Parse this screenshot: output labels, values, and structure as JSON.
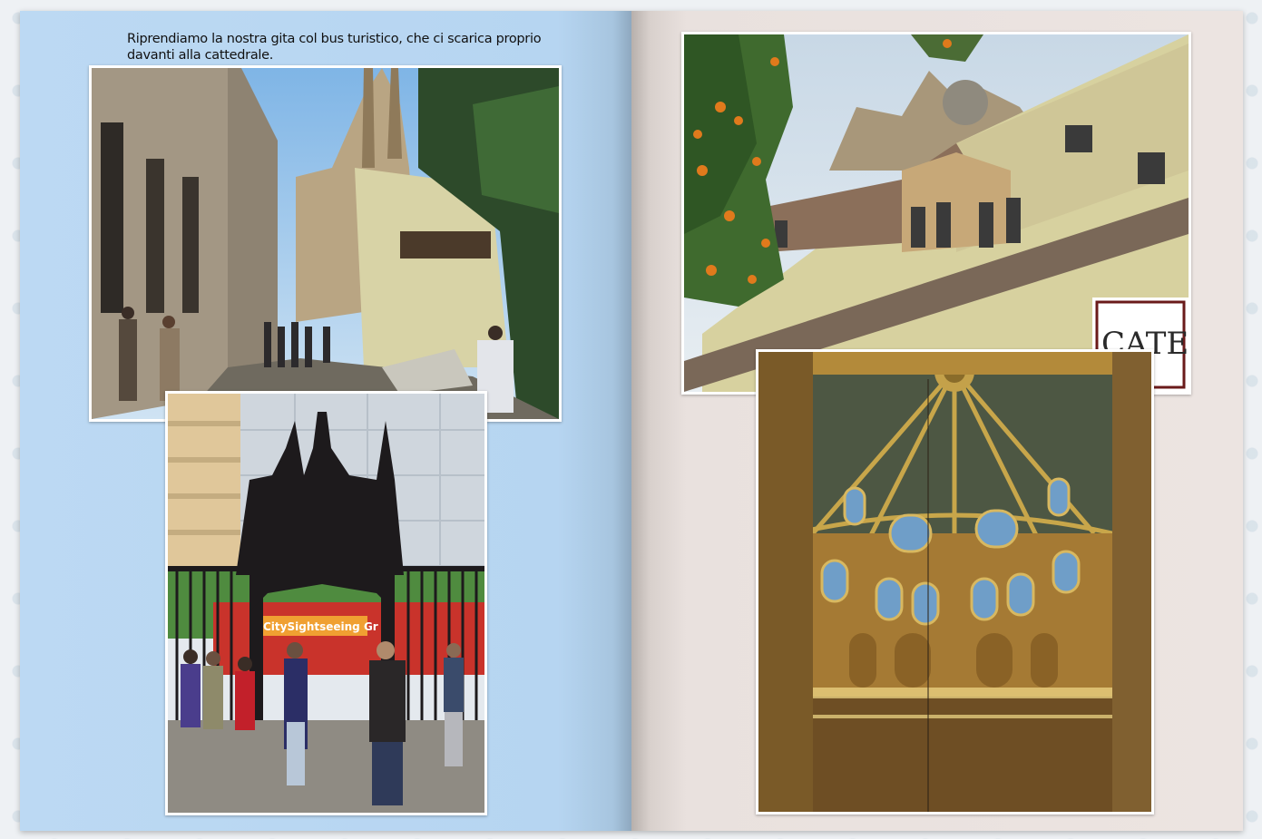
{
  "left_page": {
    "caption": "Riprendiamo la nostra gita col bus turistico, che ci scarica proprio davanti alla cattedrale.",
    "bus_sign_text": "CitySightseeing Gr"
  },
  "right_page": {
    "sign_text": "CATE"
  },
  "colors": {
    "left_page_bg": "#b6d5f1",
    "right_page_bg": "#ece4e1",
    "photo_border": "#ffffff"
  }
}
